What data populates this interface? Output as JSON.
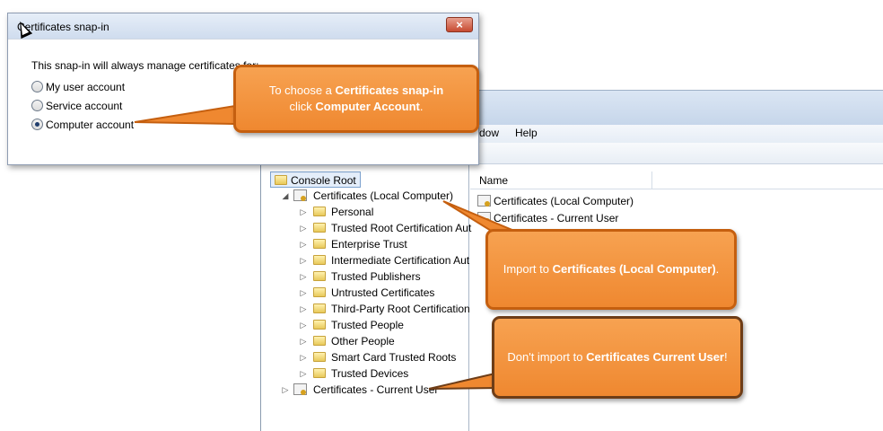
{
  "dialog": {
    "title": "Certificates snap-in",
    "close_label": "×",
    "prompt": "This snap-in will always manage certificates for:",
    "options": [
      {
        "label": "My user account",
        "checked": false
      },
      {
        "label": "Service account",
        "checked": false
      },
      {
        "label": "Computer account",
        "checked": true
      }
    ]
  },
  "mmc": {
    "menu": [
      "dow",
      "Help"
    ],
    "tree": {
      "root": "Console Root",
      "local_computer": "Certificates (Local Computer)",
      "stores": [
        "Personal",
        "Trusted Root Certification Aut",
        "Enterprise Trust",
        "Intermediate Certification Aut",
        "Trusted Publishers",
        "Untrusted Certificates",
        "Third-Party Root Certification",
        "Trusted People",
        "Other People",
        "Smart Card Trusted Roots",
        "Trusted Devices"
      ],
      "current_user": "Certificates - Current User"
    },
    "list": {
      "column": "Name",
      "rows": [
        "Certificates (Local Computer)",
        "Certificates - Current User"
      ]
    }
  },
  "callouts": {
    "snapin": {
      "pre": "To choose a ",
      "bold1": "Certificates snap-in",
      "mid": " click ",
      "bold2": "Computer Account",
      "post": "."
    },
    "import": {
      "pre": "Import to ",
      "bold1": "Certificates (Local Computer)",
      "post": "."
    },
    "dont": {
      "pre": "Don't import to ",
      "bold1": "Certificates Current User",
      "post": "!"
    }
  },
  "colors": {
    "callout_fill": "#ef8830",
    "callout_border": "#c55f0f"
  }
}
